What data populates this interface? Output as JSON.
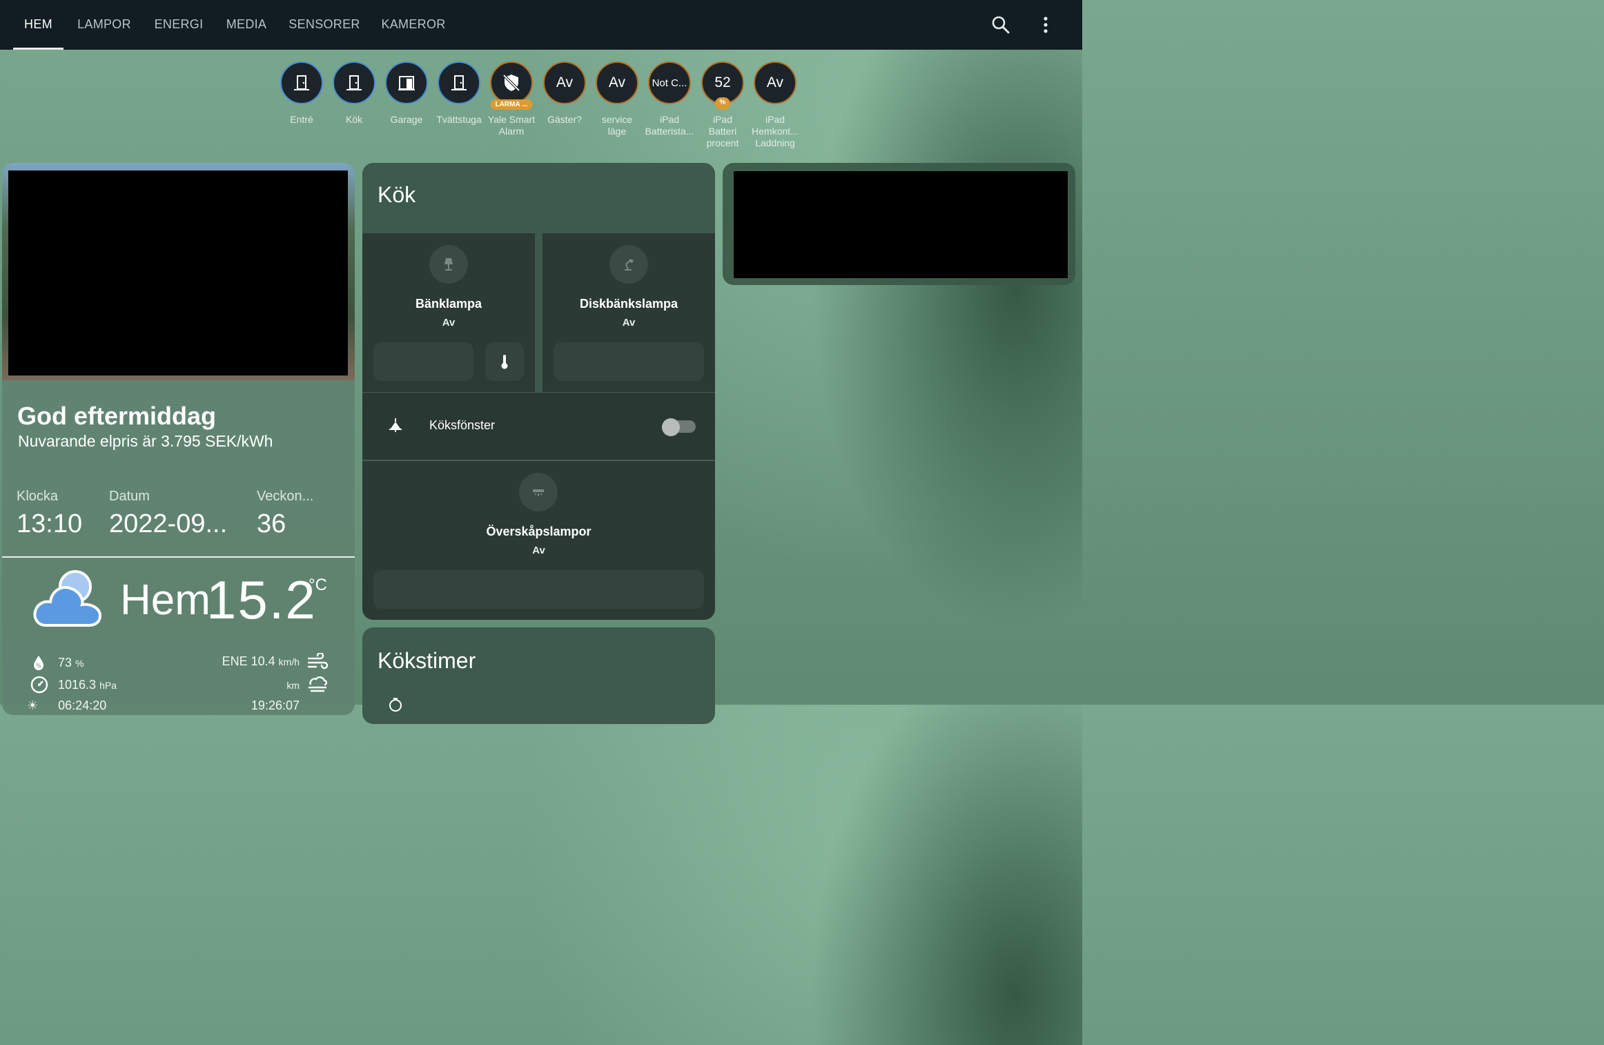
{
  "header": {
    "tabs": [
      {
        "label": "HEM",
        "active": true
      },
      {
        "label": "LAMPOR"
      },
      {
        "label": "ENERGI"
      },
      {
        "label": "MEDIA"
      },
      {
        "label": "SENSORER"
      },
      {
        "label": "KAMEROR"
      }
    ],
    "icons": [
      "search-icon",
      "more-vert-icon"
    ]
  },
  "badges": [
    {
      "icon": "door-icon",
      "label": "Entré"
    },
    {
      "icon": "door-icon",
      "label": "Kök"
    },
    {
      "icon": "garage-door-icon",
      "label": "Garage"
    },
    {
      "icon": "door-icon",
      "label": "Tvättstuga"
    },
    {
      "icon": "shield-off-icon",
      "tag": "LARMA ...",
      "label": "Yale Smart\nAlarm"
    },
    {
      "value": "Av",
      "label": "Gäster?"
    },
    {
      "value": "Av",
      "label": "service\nläge"
    },
    {
      "value": "Not C...",
      "label": "iPad\nBatterista..."
    },
    {
      "value": "52",
      "tag": "%",
      "label": "iPad\nBatteri\nprocent"
    },
    {
      "value": "Av",
      "label": "iPad\nHemkont...\nLaddning"
    }
  ],
  "greeting": {
    "title": "God eftermiddag",
    "subtitle": "Nuvarande elpris är 3.795 SEK/kWh",
    "items": [
      {
        "label": "Klocka",
        "value": "13:10"
      },
      {
        "label": "Datum",
        "value": "2022-09..."
      },
      {
        "label": "Veckon...",
        "value": "36"
      }
    ]
  },
  "weather": {
    "icon": "cloud-icon",
    "name": "Hem",
    "temperature": "15.2",
    "unit": "°C",
    "humidity": "73",
    "humidity_unit": "%",
    "pressure": "1016.3",
    "pressure_unit": "hPa",
    "wind": "ENE 10.4",
    "wind_unit": "km/h",
    "visibility_unit": "km",
    "sunrise": "06:24:20",
    "sunset": "19:26:07"
  },
  "kok": {
    "title": "Kök",
    "tiles": [
      {
        "name": "Bänklampa",
        "state": "Av",
        "icon": "lamp-icon"
      },
      {
        "name": "Diskbänkslampa",
        "state": "Av",
        "icon": "desk-lamp-icon"
      },
      {
        "name": "Överskåpslampor",
        "state": "Av",
        "icon": "ceiling-light-icon"
      }
    ],
    "window_row": {
      "name": "Köksfönster",
      "icon": "window-lamp-icon",
      "on": false
    }
  },
  "timer": {
    "title": "Kökstimer"
  },
  "colors": {
    "header_bg": "#111d22",
    "badge_border_blue": "#4a8fd0",
    "badge_border_orange": "#b5712a",
    "badge_tag": "#d99b33",
    "card_dark": "#3d5a4c",
    "cloud": "#5b9ae0"
  }
}
